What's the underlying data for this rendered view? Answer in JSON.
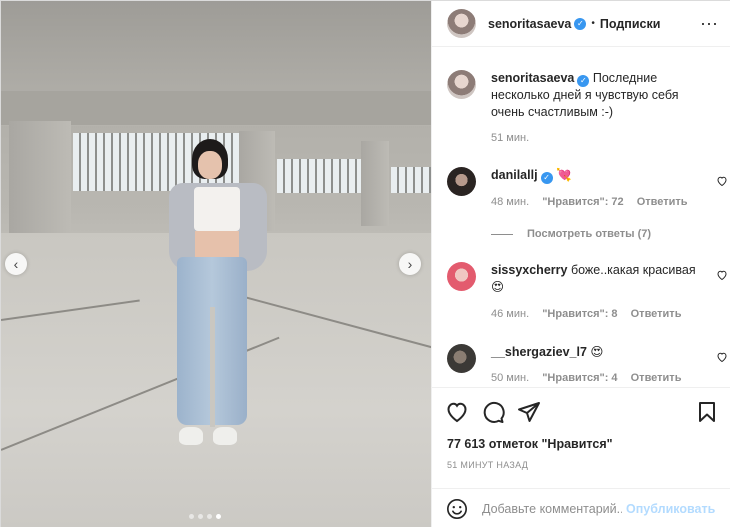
{
  "photo": {
    "nav_prev": "‹",
    "nav_next": "›",
    "dots_count": 4,
    "active_dot": 3
  },
  "header": {
    "username": "senoritasaeva",
    "verified": "✓",
    "separator": "•",
    "follow_label": "Подписки",
    "more": "···"
  },
  "caption": {
    "username": "senoritasaeva",
    "text": "Последние несколько дней я чувствую себя очень счастливым :-)",
    "time": "51 мин."
  },
  "comments": [
    {
      "username": "danilallj",
      "verified": true,
      "text": "💘",
      "time": "48 мин.",
      "likes": "\"Нравится\": 72",
      "reply": "Ответить"
    },
    {
      "username": "sissyxcherry",
      "verified": false,
      "text": "боже..какая красивая 😍",
      "time": "46 мин.",
      "likes": "\"Нравится\": 8",
      "reply": "Ответить"
    },
    {
      "username": "__shergaziev_l7",
      "verified": false,
      "text": "😍",
      "time": "50 мин.",
      "likes": "\"Нравится\": 4",
      "reply": "Ответить"
    }
  ],
  "view_replies": "Посмотреть ответы (7)",
  "likes_text": "77 613 отметок \"Нравится\"",
  "time_ago": "51 МИНУТ НАЗАД",
  "add_comment": {
    "placeholder": "Добавьте комментарий...",
    "publish_label": "Опубликовать"
  },
  "colors": {
    "verified": "#3897f0",
    "publish": "#b3dbff",
    "muted": "#8e8e8e"
  }
}
